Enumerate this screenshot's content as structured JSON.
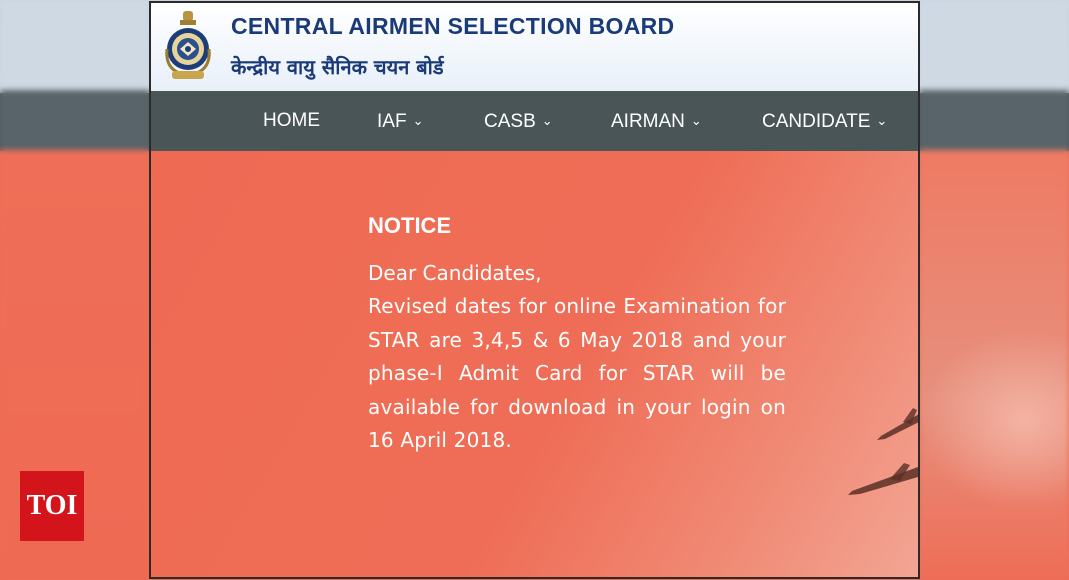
{
  "header": {
    "title_en": "CENTRAL AIRMEN SELECTION BOARD",
    "title_hi": "केन्द्रीय वायु सैनिक चयन बोर्ड",
    "emblem_icon": "iaf-emblem-icon"
  },
  "nav": {
    "items": [
      {
        "label": "HOME",
        "has_dropdown": false
      },
      {
        "label": "IAF",
        "has_dropdown": true
      },
      {
        "label": "CASB",
        "has_dropdown": true
      },
      {
        "label": "AIRMAN",
        "has_dropdown": true
      },
      {
        "label": "CANDIDATE",
        "has_dropdown": true
      }
    ],
    "dropdown_glyph": "⌄"
  },
  "notice": {
    "title": "NOTICE",
    "greeting": "Dear Candidates,",
    "body": "Revised dates for online Examination for STAR are 3,4,5 & 6 May 2018 and your phase-I Admit Card for STAR will be available for download in your login on 16 April 2018."
  },
  "watermark": {
    "label": "TOI"
  },
  "colors": {
    "header_title": "#1b3a78",
    "nav_bg": "#4a5558",
    "hero_bg": "#ef6b54",
    "watermark_bg": "#d3141b"
  }
}
